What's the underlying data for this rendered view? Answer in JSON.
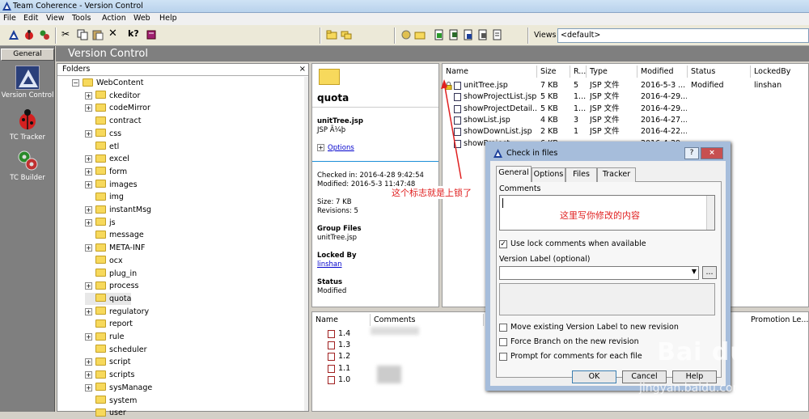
{
  "window": {
    "title": "Team Coherence - Version Control"
  },
  "menu": [
    "File",
    "Edit",
    "View",
    "Tools",
    "Action",
    "Web",
    "Help"
  ],
  "toolbar": {
    "views_label": "Views",
    "views_value": "<default>"
  },
  "sidebar": {
    "general": "General",
    "items": [
      {
        "label": "Version Control",
        "icon": "triangle-logo-icon"
      },
      {
        "label": "TC Tracker",
        "icon": "ladybug-icon"
      },
      {
        "label": "TC Builder",
        "icon": "gears-icon"
      }
    ]
  },
  "header": {
    "title": "Version Control"
  },
  "folders": {
    "title": "Folders",
    "close": "×",
    "items": [
      {
        "label": "WebContent",
        "exp": "−"
      },
      {
        "label": "ckeditor",
        "exp": "+"
      },
      {
        "label": "codeMirror",
        "exp": "+"
      },
      {
        "label": "contract",
        "exp": ""
      },
      {
        "label": "css",
        "exp": "+"
      },
      {
        "label": "etl",
        "exp": ""
      },
      {
        "label": "excel",
        "exp": "+"
      },
      {
        "label": "form",
        "exp": "+"
      },
      {
        "label": "images",
        "exp": "+"
      },
      {
        "label": "img",
        "exp": ""
      },
      {
        "label": "instantMsg",
        "exp": "+"
      },
      {
        "label": "js",
        "exp": "+"
      },
      {
        "label": "message",
        "exp": ""
      },
      {
        "label": "META-INF",
        "exp": "+"
      },
      {
        "label": "ocx",
        "exp": ""
      },
      {
        "label": "plug_in",
        "exp": ""
      },
      {
        "label": "process",
        "exp": "+"
      },
      {
        "label": "quota",
        "exp": ""
      },
      {
        "label": "regulatory",
        "exp": "+"
      },
      {
        "label": "report",
        "exp": ""
      },
      {
        "label": "rule",
        "exp": "+"
      },
      {
        "label": "scheduler",
        "exp": ""
      },
      {
        "label": "script",
        "exp": "+"
      },
      {
        "label": "scripts",
        "exp": "+"
      },
      {
        "label": "sysManage",
        "exp": "+"
      },
      {
        "label": "system",
        "exp": ""
      },
      {
        "label": "user",
        "exp": ""
      }
    ]
  },
  "details": {
    "folder_name": "quota",
    "file_name": "unitTree.jsp",
    "file_type": "JSP Ã¼þ",
    "options": "Options",
    "checked_in": "Checked in: 2016-4-28 9:42:54",
    "modified": "Modified: 2016-5-3 11:47:48",
    "size": "Size: 7 KB",
    "revisions": "Revisions: 5",
    "group_files_label": "Group Files",
    "group_files_value": "unitTree.jsp",
    "locked_by_label": "Locked By",
    "locked_by_value": "linshan",
    "status_label": "Status",
    "status_value": "Modified"
  },
  "files": {
    "columns": [
      "Name",
      "Size",
      "R...",
      "Type",
      "Modified",
      "Status",
      "LockedBy"
    ],
    "rows": [
      [
        "unitTree.jsp",
        "7 KB",
        "5",
        "JSP 文件",
        "2016-5-3 ...",
        "Modified",
        "linshan"
      ],
      [
        "showProjectList.jsp",
        "5 KB",
        "1...",
        "JSP 文件",
        "2016-4-29...",
        "",
        ""
      ],
      [
        "showProjectDetail...",
        "5 KB",
        "1...",
        "JSP 文件",
        "2016-4-29...",
        "",
        ""
      ],
      [
        "showList.jsp",
        "4 KB",
        "3",
        "JSP 文件",
        "2016-4-27...",
        "",
        ""
      ],
      [
        "showDownList.jsp",
        "2 KB",
        "1",
        "JSP 文件",
        "2016-4-22...",
        "",
        ""
      ],
      [
        "showProject...",
        "6 KB",
        "",
        "",
        "2016-4-29...",
        "",
        ""
      ]
    ]
  },
  "revisions": {
    "columns": [
      "Name",
      "Comments",
      "Promotion Le..."
    ],
    "items": [
      "1.4",
      "1.3",
      "1.2",
      "1.1",
      "1.0"
    ]
  },
  "annotations": {
    "lock_note": "这个标志就是上锁了",
    "comment_note": "这里写你修改的内容"
  },
  "dialog": {
    "title": "Check in files",
    "help": "?",
    "close": "×",
    "tabs": [
      "General",
      "Options",
      "Files",
      "Tracker"
    ],
    "comments_label": "Comments",
    "use_lock": "Use lock comments when available",
    "version_label": "Version Label (optional)",
    "browse": "...",
    "move_label": "Move existing Version Label to new revision",
    "force_branch": "Force Branch on the new revision",
    "prompt_comments": "Prompt for comments for each file",
    "ok": "OK",
    "cancel": "Cancel",
    "help_btn": "Help"
  },
  "watermark": {
    "text": "Bai du 经验",
    "url": "jingyan.baidu.com"
  },
  "colors": {
    "panel_gray": "#7f7f7f",
    "annotation_red": "#e02020",
    "link_blue": "#0000cc"
  }
}
